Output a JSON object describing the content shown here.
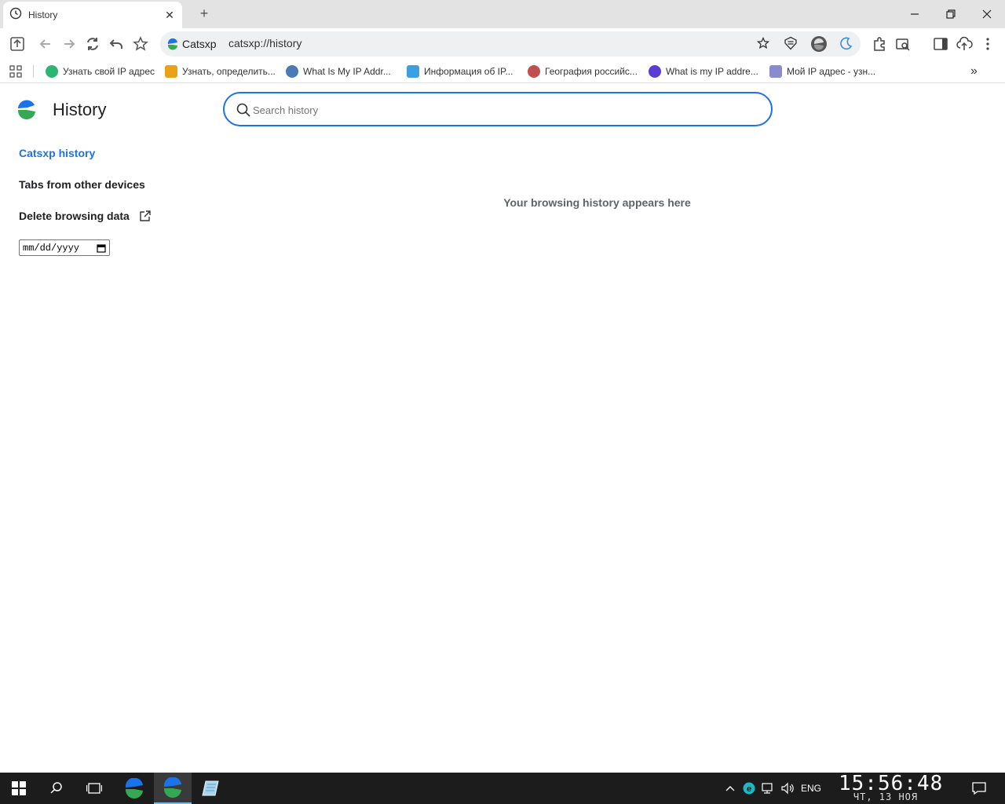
{
  "window": {
    "tab_title": "History",
    "tab_close": "✕",
    "new_tab": "+",
    "minimize": "—",
    "restore": "❐",
    "close": "✕"
  },
  "toolbar": {
    "site_label": "Catsxp",
    "url": "catsxp://history"
  },
  "bookmarks": [
    {
      "label": "Узнать свой IP адрес",
      "color": "#2bb673"
    },
    {
      "label": "Узнать, определить...",
      "color": "#e8a317"
    },
    {
      "label": "What Is My IP Addr...",
      "color": "#4a7bb7"
    },
    {
      "label": "Информация об IP...",
      "color": "#3aa0e0"
    },
    {
      "label": "География российс...",
      "color": "#c0504d"
    },
    {
      "label": "What is my IP addre...",
      "color": "#5b3bd6"
    },
    {
      "label": "Мой IP адрес - узн...",
      "color": "#8a8ad0"
    }
  ],
  "bookmarks_overflow": "»",
  "page": {
    "title": "History",
    "search_placeholder": "Search history",
    "nav": {
      "history": "Catsxp history",
      "other_devices": "Tabs from other devices",
      "delete": "Delete browsing data"
    },
    "date_placeholder": "mm/dd/yyyy",
    "empty_message": "Your browsing history appears here"
  },
  "taskbar": {
    "lang": "ENG",
    "time": "15:56:48",
    "date": "ЧТ, 13 НОЯ"
  },
  "colors": {
    "accent": "#1a73e8",
    "taskbar": "#1c1c1c"
  }
}
